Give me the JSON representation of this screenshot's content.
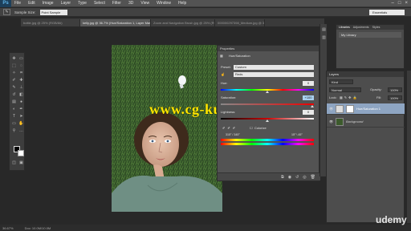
{
  "menubar": {
    "app_logo": "Ps",
    "items": [
      "File",
      "Edit",
      "Image",
      "Layer",
      "Type",
      "Select",
      "Filter",
      "3D",
      "View",
      "Window",
      "Help"
    ]
  },
  "options": {
    "sample_size_label": "Sample Size:",
    "sample_size_value": "Point Sample",
    "workspace": "Essentials"
  },
  "tabs": [
    {
      "label": "bottle.jpg @ 25% (RGB/8#)"
    },
    {
      "label": "kelly.jpg @ 36.7% (Hue/Saturation 1, Layer Mask/8) *"
    },
    {
      "label": "Zoom and Navigation Brush.jpg @ 25% (RGB/..."
    },
    {
      "label": "000000297398_Medium.jpg @ 33.3% (L..."
    }
  ],
  "watermark": "www.cg-ku.com",
  "status": {
    "zoom": "36.67%",
    "doc": "Doc: 10.0M/10.0M"
  },
  "properties": {
    "title": "Properties",
    "subtitle": "Hue/Saturation",
    "preset_label": "Preset:",
    "preset_value": "Custom",
    "channel_value": "Reds",
    "hue_label": "Hue:",
    "hue_value": "0",
    "saturation_label": "Saturation:",
    "saturation_value": "+100",
    "lightness_label": "Lightness:",
    "lightness_value": "0",
    "colorize_label": "Colorize",
    "range_left": "315° / 345°",
    "range_right": "15° \\ 45°"
  },
  "libraries": {
    "tabs": [
      "Libraries",
      "Adjustments",
      "Styles"
    ],
    "active_tab": "Libraries",
    "selected": "My Library"
  },
  "layers": {
    "title": "Layers",
    "kind": "Kind",
    "blend": "Normal",
    "opacity_label": "Opacity:",
    "opacity_value": "100%",
    "lock_label": "Lock:",
    "fill_label": "Fill:",
    "fill_value": "100%",
    "items": [
      {
        "name": "Hue/Saturation 1"
      },
      {
        "name": "Background"
      }
    ]
  },
  "branding": "udemy"
}
